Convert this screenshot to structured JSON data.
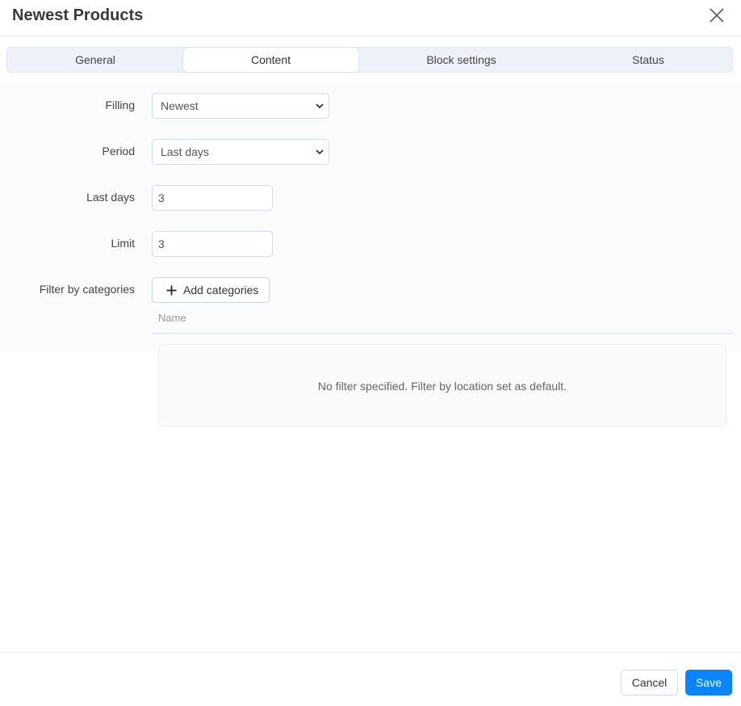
{
  "dialog": {
    "title": "Newest Products",
    "close_icon": "close-icon"
  },
  "tabs": [
    {
      "label": "General",
      "active": false
    },
    {
      "label": "Content",
      "active": true
    },
    {
      "label": "Block settings",
      "active": false
    },
    {
      "label": "Status",
      "active": false
    }
  ],
  "form": {
    "filling": {
      "label": "Filling",
      "value": "Newest"
    },
    "period": {
      "label": "Period",
      "value": "Last days"
    },
    "last_days": {
      "label": "Last days",
      "value": "3"
    },
    "limit": {
      "label": "Limit",
      "value": "3"
    },
    "filter_by_categories": {
      "label": "Filter by categories",
      "add_button_label": "Add categories",
      "add_icon": "plus-icon",
      "table_header_name": "Name",
      "empty_message": "No filter specified. Filter by location set as default."
    }
  },
  "footer": {
    "cancel_label": "Cancel",
    "save_label": "Save"
  },
  "colors": {
    "primary": "#0a84ff",
    "tab_bar_bg": "#eef1f8"
  }
}
